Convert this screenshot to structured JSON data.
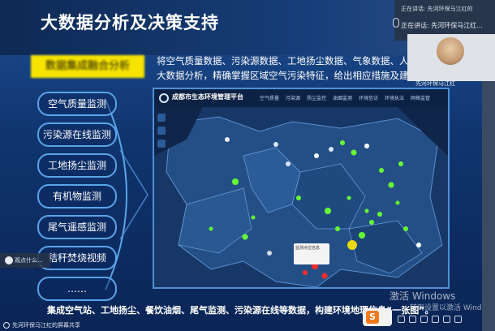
{
  "slide": {
    "title": "大数据分析及决策支持",
    "tag_label": "数据集成融合分析",
    "description_lines": [
      "将空气质量数据、污染源数据、工地扬尘数据、气象数据、人类活",
      "大数据分析，精确掌握区域空气污染特征，给出相应措施及建议。"
    ],
    "side_items": [
      "空气质量监测",
      "污染源在线监测",
      "工地扬尘监测",
      "有机物监测",
      "尾气遥感监测",
      "秸秆焚烧视频",
      "……"
    ],
    "bottom_caption": "集成空气站、工地扬尘、餐饮油烟、尾气监测、污染源在线等数据，构建环境地理信息“一张图”。"
  },
  "map": {
    "title": "成都市生态环境管理平台",
    "nav_items": [
      "空气质量",
      "污染源",
      "扬尘监控",
      "油烟监测",
      "环境信访",
      "环境执法",
      "网格监管"
    ],
    "popup_text": "监测点位信息"
  },
  "meeting": {
    "top_line": "正在讲话: 先河环保马江红的",
    "speaking_line": "正在讲话: 先河环保马江红...",
    "participant_name": "先河环保马江红",
    "left_participant": "观点什么...",
    "screen_share_label": "先河环保马江红的屏幕共享"
  },
  "watermark": {
    "line1": "激活 Windows",
    "line2": "转到设置以激活 Windows。"
  },
  "badge_letter": "S",
  "colors": {
    "accent_yellow": "#f6e300",
    "slide_blue": "#10356f",
    "pill_border": "#5aa4e8",
    "pollution_red": "#ff2a2a",
    "station_green": "#66ff33"
  }
}
